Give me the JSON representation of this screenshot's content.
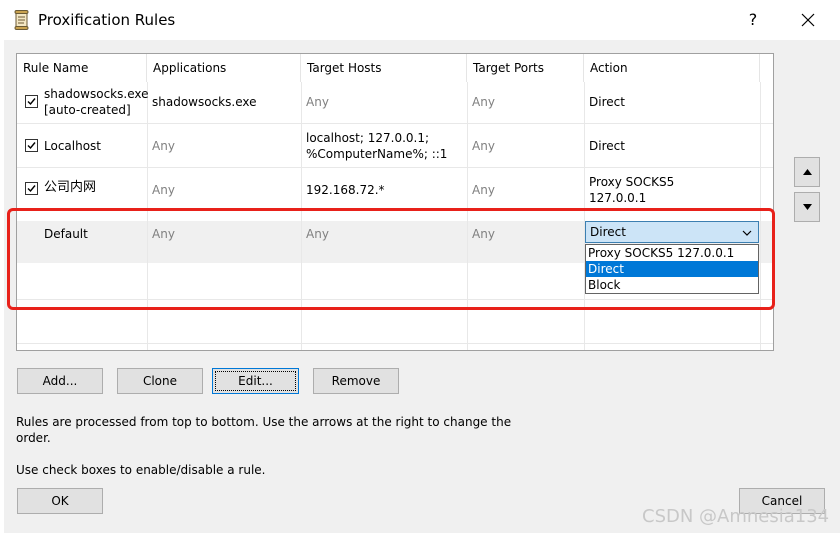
{
  "window": {
    "title": "Proxification Rules",
    "help_label": "?"
  },
  "columns": [
    "Rule Name",
    "Applications",
    "Target Hosts",
    "Target Ports",
    "Action"
  ],
  "rules": [
    {
      "checked": true,
      "name_line1": "shadowsocks.exe",
      "name_line2": "[auto-created]",
      "applications": "shadowsocks.exe",
      "target_hosts": "Any",
      "target_ports": "Any",
      "action": "Direct"
    },
    {
      "checked": true,
      "name_line1": "Localhost",
      "applications": "Any",
      "target_hosts_line1": "localhost; 127.0.0.1;",
      "target_hosts_line2": "%ComputerName%; ::1",
      "target_ports": "Any",
      "action": "Direct"
    },
    {
      "checked": true,
      "name_line1": "公司内网",
      "applications": "Any",
      "target_hosts": "192.168.72.*",
      "target_ports": "Any",
      "action_line1": "Proxy SOCKS5",
      "action_line2": "127.0.0.1"
    },
    {
      "name_line1": "Default",
      "applications": "Any",
      "target_hosts": "Any",
      "target_ports": "Any",
      "action_selected": "Direct"
    }
  ],
  "action_dropdown": {
    "options": [
      "Proxy SOCKS5 127.0.0.1",
      "Direct",
      "Block"
    ],
    "highlighted": "Direct"
  },
  "buttons": {
    "add": "Add...",
    "clone": "Clone",
    "edit": "Edit...",
    "remove": "Remove",
    "ok": "OK",
    "cancel": "Cancel"
  },
  "info": {
    "line1": "Rules are processed from top to bottom. Use the arrows at the right to change the",
    "line2": "order.",
    "line3": "Use check boxes to enable/disable a rule."
  },
  "watermark": "CSDN @Amnesia134",
  "icons": {
    "title": "scroll-document-icon",
    "close": "close-icon",
    "move_up": "triangle-up-icon",
    "move_down": "triangle-down-icon",
    "dropdown": "chevron-down-icon"
  },
  "colors": {
    "highlight_box": "#e8211a",
    "selection": "#0078d7",
    "dropdown_bg": "#cce4f7"
  }
}
